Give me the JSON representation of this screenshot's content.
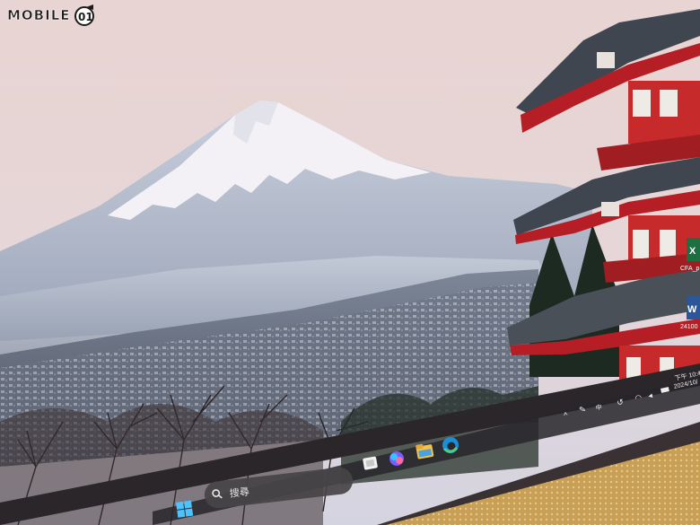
{
  "watermark": {
    "text": "MOBILE",
    "logo": "mobile01-logo"
  },
  "taskbar": {
    "search_label": "搜尋",
    "start_icon": "windows-start-icon",
    "pinned_icons": [
      "task-view-icon",
      "copilot-icon",
      "file-explorer-icon",
      "edge-icon"
    ]
  },
  "desktop_icons": [
    {
      "icon": "excel-icon",
      "label": "CFA_p"
    },
    {
      "icon": "word-icon",
      "label": "24100"
    }
  ],
  "system_tray": {
    "ime": "中",
    "time": "下午 10:4",
    "date": "2024/10/"
  },
  "colors": {
    "sky_top": "#ead8d6",
    "sky_bottom": "#d9d3de",
    "mountain": "#b8bfd0",
    "snow": "#f4f2f6",
    "pagoda_roof": "#3f4650",
    "pagoda_red": "#b41e24",
    "keyboard_gold": "#d9b878",
    "bezel": "#2b2629"
  }
}
